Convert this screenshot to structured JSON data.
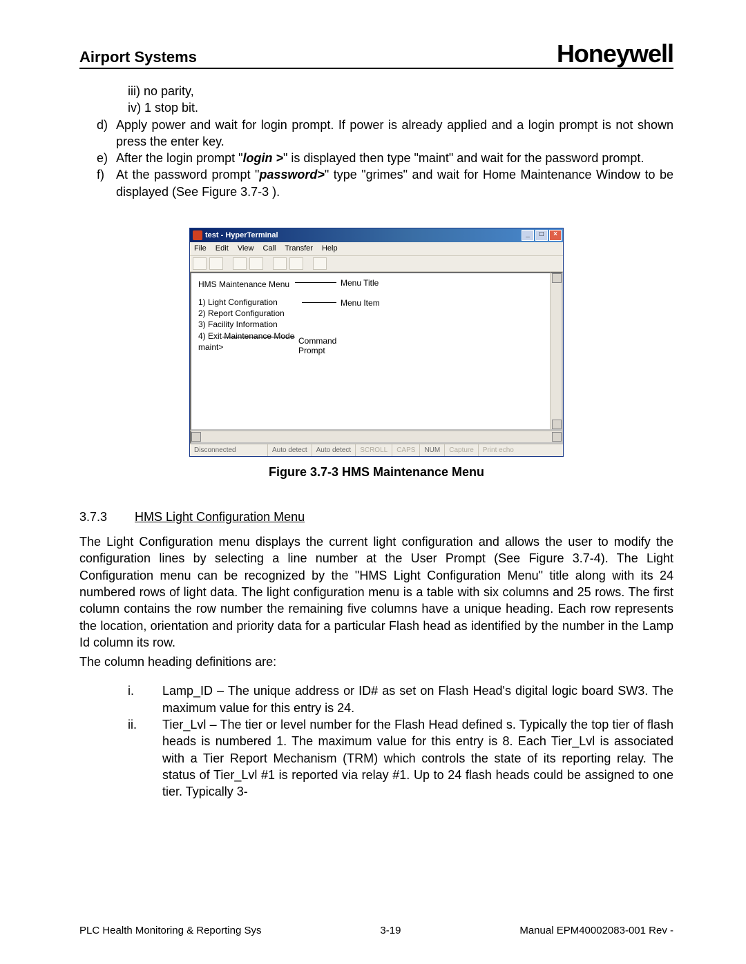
{
  "header": {
    "left": "Airport Systems",
    "right": "Honeywell"
  },
  "top_sub": [
    "iii)  no parity,",
    "iv)  1 stop bit."
  ],
  "steps": [
    {
      "m": "d)",
      "t": "Apply power and wait for login prompt.  If power is already applied and a login prompt is not shown press the enter key."
    },
    {
      "m": "e)",
      "pre": "After the login prompt \"",
      "em": "login >",
      "post": "\" is displayed then type \"maint\" and wait for the password prompt."
    },
    {
      "m": "f)",
      "pre": "At the password prompt \"",
      "em": "password>",
      "post": "\" type \"grimes\" and wait for Home Maintenance Window to be displayed (See Figure 3.7-3 )."
    }
  ],
  "terminal": {
    "title": "test - HyperTerminal",
    "menu": [
      "File",
      "Edit",
      "View",
      "Call",
      "Transfer",
      "Help"
    ],
    "menu_title": "HMS Maintenance Menu",
    "items": [
      "1)  Light Configuration",
      "2)  Report Configuration",
      "3)  Facility Information",
      "4)  Exit Maintenance Mode"
    ],
    "prompt": "maint>",
    "callouts": {
      "title": "Menu Title",
      "item": "Menu Item",
      "prompt1": "Command",
      "prompt2": "Prompt"
    },
    "status": {
      "conn": "Disconnected",
      "d1": "Auto detect",
      "d2": "Auto detect",
      "scroll": "SCROLL",
      "caps": "CAPS",
      "num": "NUM",
      "capture": "Capture",
      "echo": "Print echo"
    }
  },
  "figure_caption": "Figure 3.7-3 HMS Maintenance Menu",
  "section": {
    "num": "3.7.3",
    "title": "HMS Light Configuration Menu"
  },
  "para1": "The Light Configuration menu displays the current light configuration and allows the user to modify the configuration lines by selecting a line number at the User Prompt (See Figure 3.7-4).  The Light Configuration menu can be recognized by the \"HMS Light Configuration Menu\" title along with its 24 numbered rows of light data.  The light configuration menu is a table with six columns and 25 rows.  The first column contains the row number the remaining five columns have a unique heading.  Each row represents the location, orientation and priority data for a particular Flash head as identified by the number in the Lamp Id column its row.",
  "para2": "The column heading definitions are:",
  "defs": [
    {
      "m": "i.",
      "t": "Lamp_ID – The unique address or ID# as set on Flash Head's digital logic board SW3.  The maximum value for this entry is 24."
    },
    {
      "m": "ii.",
      "t": "Tier_Lvl – The tier or level number for the Flash Head defined s.  Typically the top tier of flash heads is numbered 1.  The maximum value for this entry is 8.  Each Tier_Lvl is associated with a Tier Report Mechanism (TRM) which controls the state of its reporting relay.  The status of Tier_Lvl #1 is reported via relay #1.  Up to 24 flash heads could be assigned to one tier.  Typically 3-"
    }
  ],
  "footer": {
    "left": "PLC Health Monitoring & Reporting Sys",
    "center": "3-19",
    "right": "Manual EPM40002083-001 Rev -"
  }
}
